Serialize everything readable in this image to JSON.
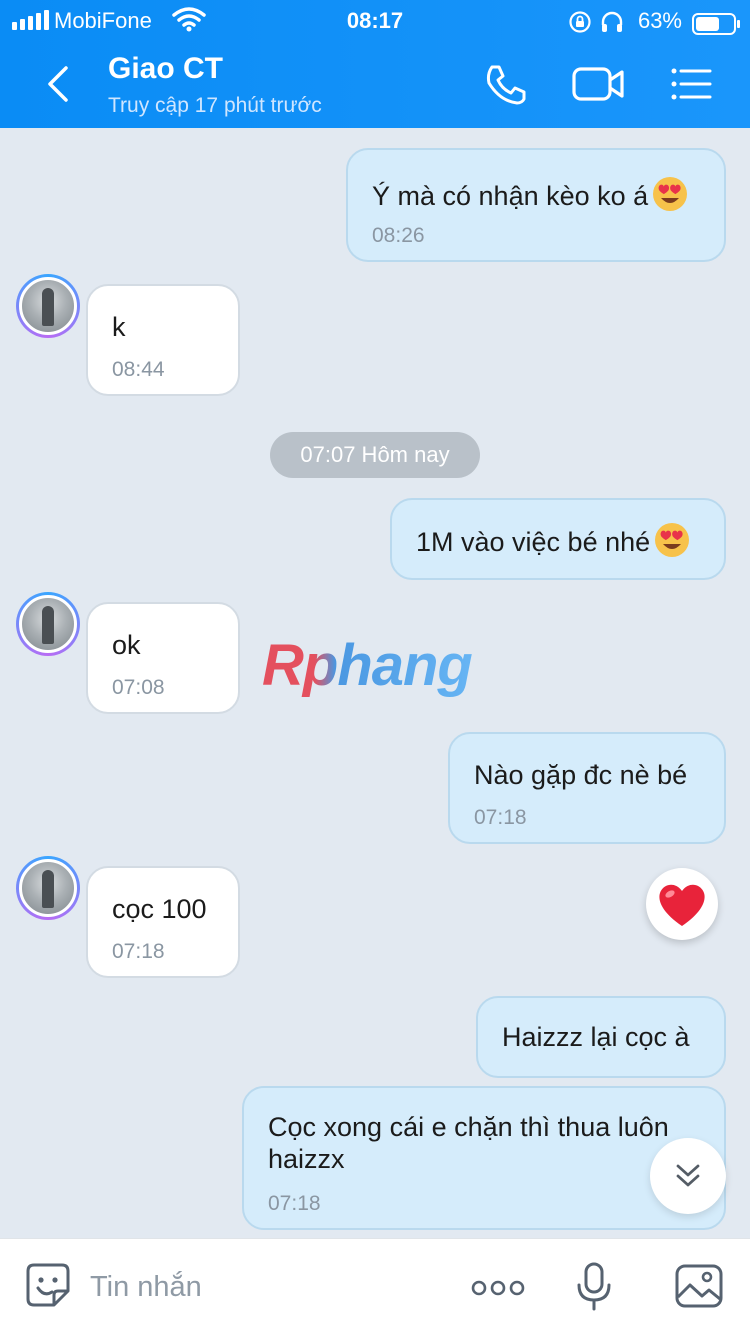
{
  "status_bar": {
    "carrier": "MobiFone",
    "time": "08:17",
    "battery": "63%",
    "battery_level": 0.63
  },
  "header": {
    "title": "Giao CT",
    "subtitle": "Truy cập 17 phút trước",
    "icons": [
      "back-chevron-icon",
      "phone-call-icon",
      "video-call-icon",
      "menu-list-icon"
    ]
  },
  "colors": {
    "header_bg": "#1a94f8",
    "outgoing_bubble": "#d5ecfb",
    "incoming_bubble": "#ffffff",
    "chat_bg": "#e2e9f1"
  },
  "messages": [
    {
      "side": "out",
      "text": "Ý mà có nhận kèo ko á",
      "time": "08:26",
      "emoji": "heart-eyes-emoji"
    },
    {
      "side": "in",
      "text": "k",
      "time": "08:44"
    },
    {
      "side": "out",
      "text": "1M vào việc bé nhé",
      "emoji": "heart-eyes-emoji"
    },
    {
      "side": "in",
      "text": "ok",
      "time": "07:08"
    },
    {
      "side": "out",
      "text": "Nào gặp đc nè bé",
      "time": "07:18"
    },
    {
      "side": "in",
      "text": "cọc 100",
      "time": "07:18"
    },
    {
      "side": "out",
      "text": "Haizzz lại cọc à"
    },
    {
      "side": "out",
      "text_line1": "Cọc xong cái e chặn thì thua luôn",
      "text_line2": "haizzx",
      "time": "07:18"
    }
  ],
  "date_divider": "07:07 Hôm nay",
  "watermark": "Rphang",
  "composer": {
    "placeholder": "Tin nhắn",
    "icons": [
      "sticker-icon",
      "more-dots-icon",
      "microphone-icon",
      "photo-icon"
    ]
  }
}
